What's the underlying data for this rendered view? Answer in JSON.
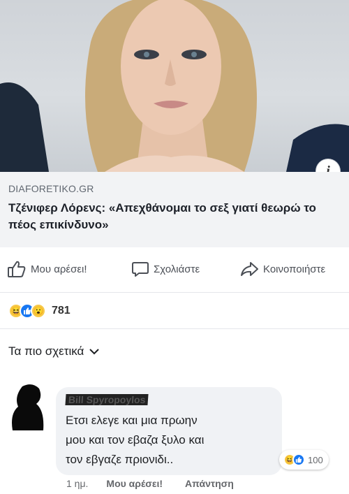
{
  "post": {
    "link_source": "DIAFORETIKO.GR",
    "link_title": "Τζένιφερ Λόρενς: «Απεχθάνομαι το σεξ γιατί θεωρώ το πέος επικίνδυνο»",
    "info_icon": "info-icon"
  },
  "actions": {
    "like_label": "Μου αρέσει!",
    "comment_label": "Σχολιάστε",
    "share_label": "Κοινοποιήστε"
  },
  "reactions": {
    "icons": [
      "haha",
      "like",
      "wow"
    ],
    "count": "781"
  },
  "filter": {
    "label": "Τα πιο σχετικά"
  },
  "comment": {
    "author": "Bill Spyropoylos",
    "text": "Ετσι ελεγε και μια πρωην\nμου και τον εβαζα ξυλο και\nτον εβγαζε πριονιδι..",
    "reaction_count": "100",
    "time": "1 ημ.",
    "like_label": "Μου αρέσει!",
    "reply_label": "Απάντηση"
  },
  "colors": {
    "like_blue": "#1877f2",
    "haha_yellow": "#f7c948",
    "card_bg": "#f2f3f5"
  }
}
